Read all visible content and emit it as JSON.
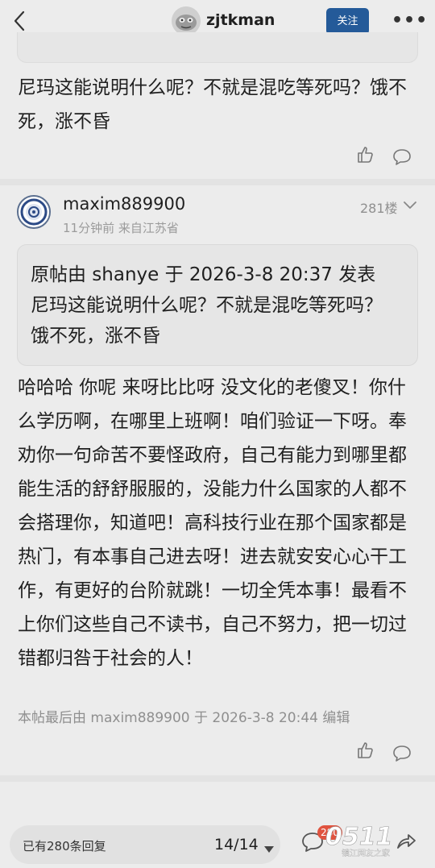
{
  "header": {
    "username": "zjtkman",
    "follow_label": "关注",
    "more_label": "•••"
  },
  "previous_post": {
    "text": "尼玛这能说明什么呢？不就是混吃等死吗？饿不死，涨不昏"
  },
  "post": {
    "author": "maxim889900",
    "meta": "11分钟前 来自江苏省",
    "floor": "281楼",
    "quote": {
      "header": "原帖由 shanye 于 2026-3-8 20:37 发表",
      "text": "尼玛这能说明什么呢？不就是混吃等死吗？饿不死，涨不昏"
    },
    "body": "哈哈哈 你呢 来呀比比呀 没文化的老傻叉！你什么学历啊，在哪里上班啊！咱们验证一下呀。奉劝你一句命苦不要怪政府，自己有能力到哪里都能生活的舒舒服服的，没能力什么国家的人都不会搭理你，知道吧！高科技行业在那个国家都是热门，有本事自己进去呀！进去就安安心心干工作，有更好的台阶就跳！一切全凭本事！最看不上你们这些自己不读书，自己不努力，把一切过错都归咎于社会的人！",
    "edit_note": "本帖最后由 maxim889900 于 2026-3-8 20:44 编辑"
  },
  "bottom_bar": {
    "reply_count": "已有280条回复",
    "page": "14/14",
    "comment_badge": "280"
  },
  "watermark": {
    "text": "0511",
    "subtext": "镇江网友之家"
  },
  "icons": {
    "back": "chevron-left-icon",
    "like": "thumbs-up-icon",
    "comment": "speech-bubble-icon",
    "floor_menu": "chevron-down-icon",
    "share": "share-icon"
  },
  "colors": {
    "accent": "#245a99",
    "badge": "#e0533f",
    "background": "#ececec",
    "muted_text": "#8f8f8f"
  }
}
